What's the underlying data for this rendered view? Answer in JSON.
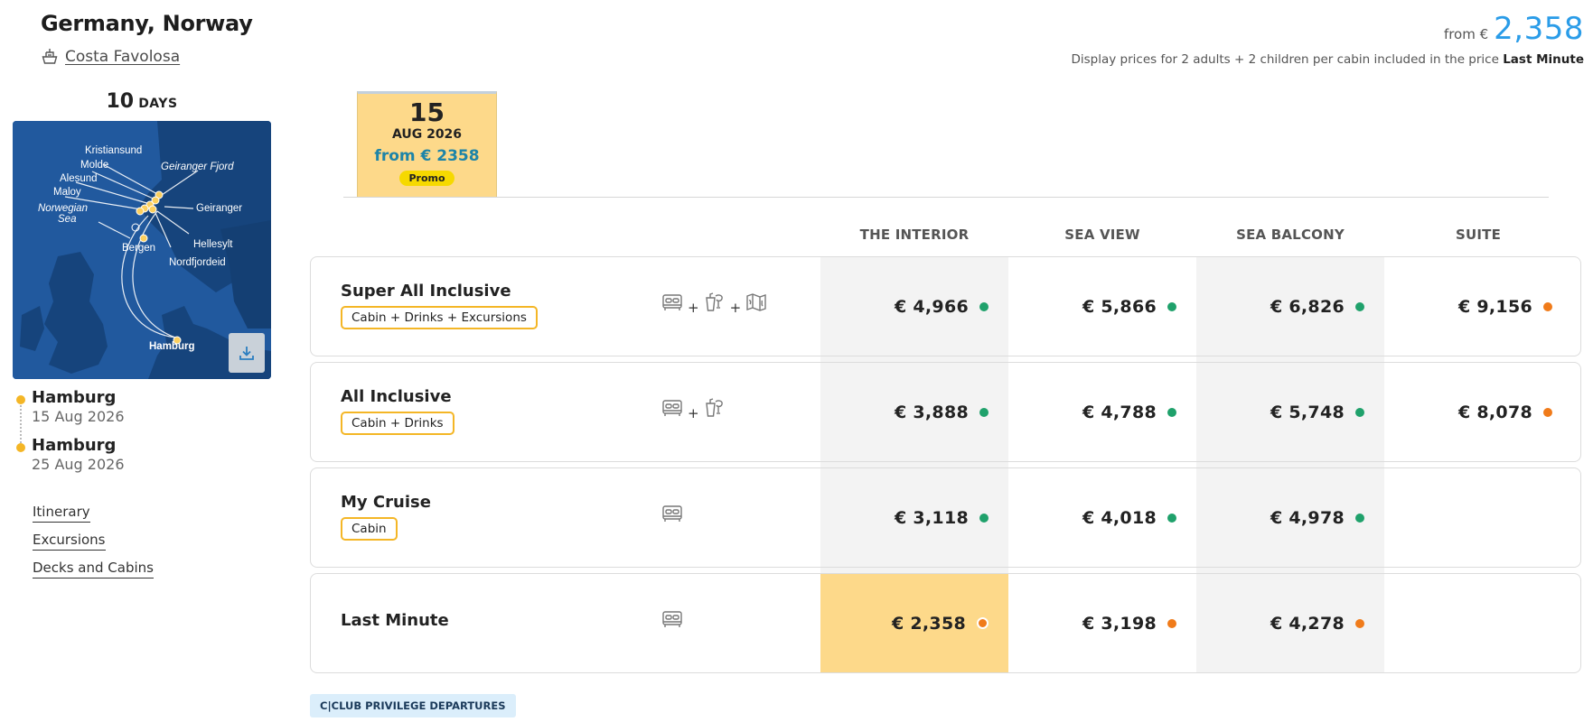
{
  "header": {
    "title": "Germany, Norway",
    "ship_name": "Costa Favolosa",
    "from_label": "from €",
    "from_value": "2,358",
    "note_prefix": "Display prices for 2 adults + 2 children per cabin included in the price",
    "note_bold": "Last Minute"
  },
  "trip": {
    "days_num": "10",
    "days_label": "DAYS",
    "map_labels": {
      "kristiansund": "Kristiansund",
      "molde": "Molde",
      "alesund": "Alesund",
      "maloy": "Maloy",
      "norwegian_sea_1": "Norwegian",
      "norwegian_sea_2": "Sea",
      "geiranger_fjord": "Geiranger Fjord",
      "geiranger": "Geiranger",
      "bergen": "Bergen",
      "hellesylt": "Hellesylt",
      "nordfjordeid": "Nordfjordeid",
      "hamburg": "Hamburg"
    },
    "departure": {
      "port": "Hamburg",
      "date": "15 Aug 2026"
    },
    "arrival": {
      "port": "Hamburg",
      "date": "25 Aug 2026"
    }
  },
  "links": {
    "itinerary": "Itinerary",
    "excursions": "Excursions",
    "decks": "Decks and Cabins"
  },
  "date_tab": {
    "day": "15",
    "month_year": "AUG 2026",
    "from_price": "from € 2358",
    "badge": "Promo"
  },
  "columns": [
    "THE INTERIOR",
    "SEA VIEW",
    "SEA BALCONY",
    "SUITE"
  ],
  "colors": {
    "available": "#1fa16b",
    "limited": "#f07b1a",
    "accent": "#2a9ce8",
    "highlight": "#fdd98a",
    "tag_border": "#f4b626"
  },
  "fares": [
    {
      "name": "Super All Inclusive",
      "tag": "Cabin + Drinks + Excursions",
      "icons": [
        "bed-icon",
        "drinks-icon",
        "map-icon"
      ],
      "prices": [
        {
          "value": "€ 4,966",
          "status": "available"
        },
        {
          "value": "€ 5,866",
          "status": "available"
        },
        {
          "value": "€ 6,826",
          "status": "available"
        },
        {
          "value": "€ 9,156",
          "status": "limited"
        }
      ]
    },
    {
      "name": "All Inclusive",
      "tag": "Cabin + Drinks",
      "icons": [
        "bed-icon",
        "drinks-icon"
      ],
      "prices": [
        {
          "value": "€ 3,888",
          "status": "available"
        },
        {
          "value": "€ 4,788",
          "status": "available"
        },
        {
          "value": "€ 5,748",
          "status": "available"
        },
        {
          "value": "€ 8,078",
          "status": "limited"
        }
      ]
    },
    {
      "name": "My Cruise",
      "tag": "Cabin",
      "icons": [
        "bed-icon"
      ],
      "prices": [
        {
          "value": "€ 3,118",
          "status": "available"
        },
        {
          "value": "€ 4,018",
          "status": "available"
        },
        {
          "value": "€ 4,978",
          "status": "available"
        }
      ]
    },
    {
      "name": "Last Minute",
      "tag": "",
      "icons": [
        "bed-icon"
      ],
      "prices": [
        {
          "value": "€ 2,358",
          "status": "limited",
          "selected": true
        },
        {
          "value": "€ 3,198",
          "status": "limited"
        },
        {
          "value": "€ 4,278",
          "status": "limited"
        }
      ]
    }
  ],
  "plus_sign": "+",
  "club_badge": "C|CLUB PRIVILEGE DEPARTURES"
}
